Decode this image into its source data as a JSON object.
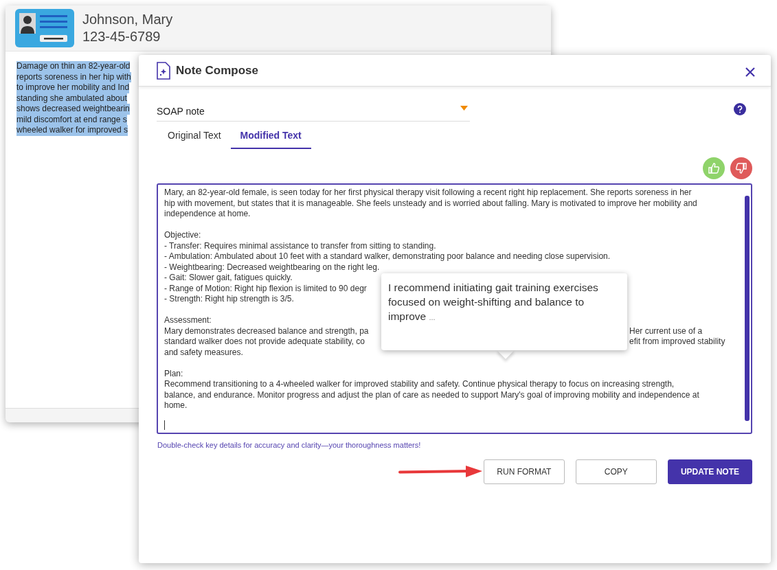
{
  "patient_window": {
    "name": "Johnson, Mary",
    "id_number": "123-45-6789",
    "selected_text_lines": [
      "Damage on thin an 82-year-old",
      "reports soreness in her hip with",
      "to improve her mobility and Ind",
      "standing she ambulated about",
      "shows decreased weightbearin",
      "mild discomfort at end range s",
      "wheeled walker for improved s"
    ]
  },
  "modal": {
    "title": "Note Compose",
    "note_type": {
      "value": "SOAP note"
    },
    "tabs": [
      {
        "label": "Original Text",
        "selected": false
      },
      {
        "label": "Modified Text",
        "selected": true
      }
    ],
    "feedback": [
      {
        "kind": "like"
      },
      {
        "kind": "dislike"
      }
    ],
    "editor_lines": [
      {
        "text": "Mary, an 82-year-old female, is seen today for her first physical therapy visit following a recent right hip replacement. She reports soreness in her"
      },
      {
        "text": "hip with movement, but states that it is manageable. She feels unsteady and is worried about falling. Mary is motivated to improve her mobility and"
      },
      {
        "text": "independence at home."
      },
      {
        "kind": "gap"
      },
      {
        "text": "Objective:"
      },
      {
        "text": "- Transfer: Requires minimal assistance to transfer from sitting to standing."
      },
      {
        "text": "- Ambulation: Ambulated about 10 feet with a standard walker, demonstrating poor balance and needing close supervision."
      },
      {
        "text": "- Weightbearing: Decreased weightbearing on the right leg."
      },
      {
        "text": "- Gait: Slower gait, fatigues quickly."
      },
      {
        "text": "- Range of Motion: Right hip flexion is limited to 90 degr"
      },
      {
        "text": "- Strength: Right hip strength is 3/5."
      },
      {
        "kind": "gap"
      },
      {
        "text": "Assessment:"
      },
      {
        "text": "Mary demonstrates decreased balance and strength, pa",
        "right": "Her current use of a"
      },
      {
        "text": "standard walker does not provide adequate stability, co",
        "right": "efit from improved stability"
      },
      {
        "text": "and safety measures."
      },
      {
        "kind": "gap"
      },
      {
        "text": "Plan:"
      },
      {
        "text": "Recommend transitioning to a 4-wheeled walker for improved stability and safety. Continue physical therapy to focus on increasing strength,"
      },
      {
        "text": "balance, and endurance. Monitor progress and adjust the plan of care as needed to support Mary's goal of improving mobility and independence at"
      },
      {
        "text": "home."
      }
    ],
    "suggestion": {
      "text": "I recommend initiating gait training exercises focused on weight-shifting and balance to improve",
      "more": "..."
    },
    "hint": "Double-check key details for accuracy and clarity—your thoroughness matters!",
    "buttons": [
      {
        "label": "RUN FORMAT",
        "kind": "outline"
      },
      {
        "label": "COPY",
        "kind": "outline"
      },
      {
        "label": "UPDATE NOTE",
        "kind": "primary"
      }
    ]
  }
}
